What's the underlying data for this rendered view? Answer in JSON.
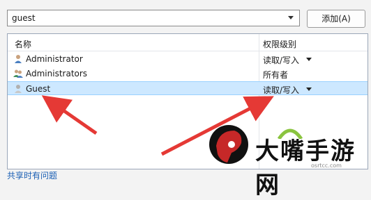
{
  "combo": {
    "value": "guest"
  },
  "add_button": {
    "label": "添加(A)"
  },
  "table": {
    "headers": {
      "name": "名称",
      "permission": "权限级别"
    },
    "rows": [
      {
        "name": "Administrator",
        "permission": "读取/写入",
        "has_dropdown": true,
        "icon": "user-icon"
      },
      {
        "name": "Administrators",
        "permission": "所有者",
        "has_dropdown": false,
        "icon": "group-icon"
      },
      {
        "name": "Guest",
        "permission": "读取/写入",
        "has_dropdown": true,
        "icon": "user-icon",
        "selected": true
      }
    ]
  },
  "footer": {
    "link": "共享时有问题"
  },
  "watermark": {
    "brand": "大嘴手游网",
    "sub": "osrtcc.com"
  },
  "colors": {
    "selection": "#cde8ff",
    "arrow": "#e53935",
    "link": "#1a5fb4"
  }
}
